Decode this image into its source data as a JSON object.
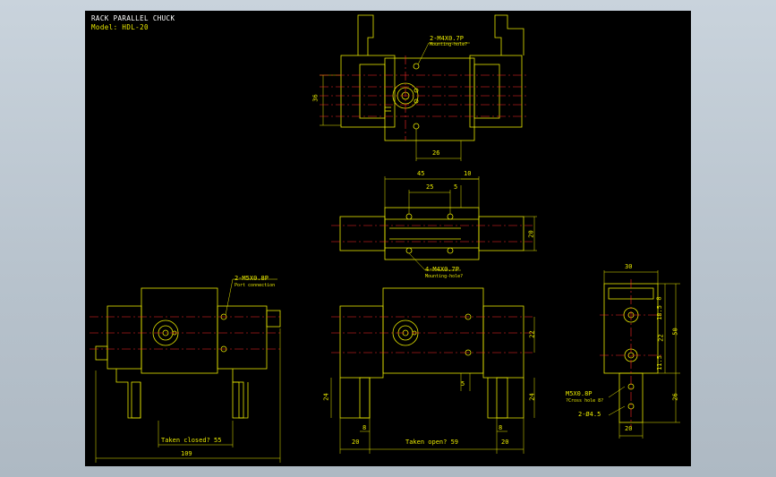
{
  "title": "RACK PARALLEL CHUCK",
  "model": "Model: HDL-20",
  "colors": {
    "background": "#000000",
    "outline": "#e8e800",
    "centerline": "#ff2a2a",
    "text": "#e8e800",
    "title": "#ffffff"
  },
  "top_view": {
    "callout": "2-M4X0.7P",
    "callout_note": "Mounting-hole?",
    "dim_height": "36",
    "dim_width": "26"
  },
  "mid_view": {
    "dim_total": "45",
    "dim_end": "10",
    "dim_pitch": "25",
    "dim_small": "5",
    "dim_height": "20",
    "callout": "4-M4X0.7P",
    "callout_note": "Mounting-hole?"
  },
  "left_view": {
    "callout": "2-M5X0.8P",
    "callout_note": "Port connection",
    "dim_closed": "Taken closed? 55",
    "dim_total": "109"
  },
  "front_view": {
    "dim_22": "22",
    "dim_5": "5",
    "dim_24_left": "24",
    "dim_24_right": "24",
    "dim_8_left": "8",
    "dim_8_right": "8",
    "dim_20_left": "20",
    "dim_20_right": "20",
    "dim_open": "Taken open? 59"
  },
  "side_view": {
    "dim_30": "30",
    "dim_8": "8",
    "dim_18_5": "18.5",
    "dim_22": "22",
    "dim_50": "50",
    "dim_11_5": "11.5",
    "dim_26": "26",
    "dim_20": "20",
    "callout_port": "M5X0.8P",
    "callout_port_note": "?Cross hole 8?",
    "callout_hole": "2-Ø4.5"
  }
}
